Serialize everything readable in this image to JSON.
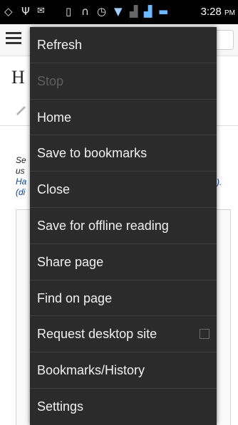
{
  "status_bar": {
    "time": "3:28",
    "ampm": "PM",
    "icons": [
      "location-icon",
      "usb-icon",
      "mail-icon",
      "vibrate-icon",
      "headset-icon",
      "alarm-icon",
      "wifi-icon",
      "signal-icon-1",
      "signal-icon-2",
      "battery-icon"
    ]
  },
  "page": {
    "heading": "H",
    "snippet_lines": [
      "Se",
      "us",
      "Ha",
      "(di"
    ],
    "snippet_right": ")."
  },
  "menu": {
    "items": [
      {
        "label": "Refresh",
        "enabled": true
      },
      {
        "label": "Stop",
        "enabled": false
      },
      {
        "label": "Home",
        "enabled": true
      },
      {
        "label": "Save to bookmarks",
        "enabled": true
      },
      {
        "label": "Close",
        "enabled": true
      },
      {
        "label": "Save for offline reading",
        "enabled": true
      },
      {
        "label": "Share page",
        "enabled": true
      },
      {
        "label": "Find on page",
        "enabled": true
      },
      {
        "label": "Request desktop site",
        "enabled": true,
        "checkbox": false
      },
      {
        "label": "Bookmarks/History",
        "enabled": true
      },
      {
        "label": "Settings",
        "enabled": true
      }
    ]
  },
  "colors": {
    "menu_background": "#2b2b2b",
    "menu_text": "#f2f2f2",
    "menu_text_disabled": "#5e5e5e",
    "link": "#0645ad"
  }
}
